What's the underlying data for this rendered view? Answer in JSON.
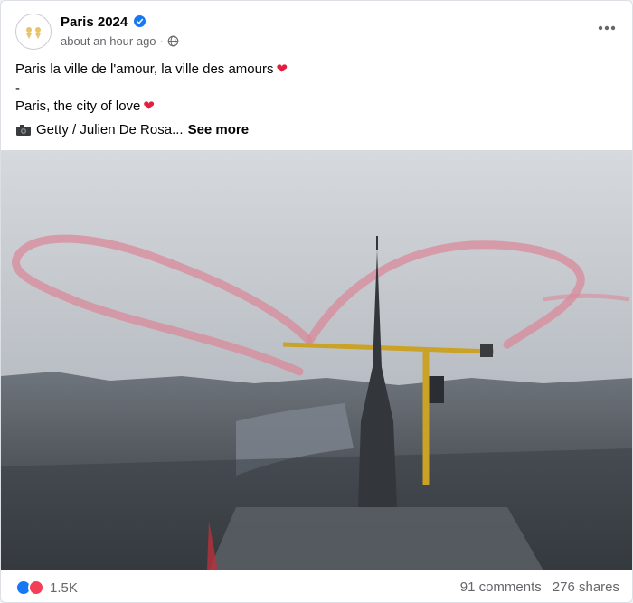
{
  "post": {
    "page_name": "Paris 2024",
    "timestamp": "about an hour ago",
    "text_lines": [
      "Paris la ville de l'amour, la ville des amours",
      "-",
      "Paris, the city of love"
    ],
    "caption_prefix": "Getty / Julien De Rosa...",
    "see_more": "See more",
    "photo_alt": "Aerial view of Paris with a red smoke heart in the sky above a cathedral spire and a construction crane"
  },
  "footer": {
    "reaction_count": "1.5K",
    "comments": "91 comments",
    "shares": "276 shares"
  },
  "icons": {
    "verified": "verified-badge-icon",
    "globe": "globe-icon",
    "more": "more-options-icon",
    "camera": "camera-icon",
    "heart": "red-heart-emoji",
    "like": "like-reaction-icon",
    "love": "love-reaction-icon"
  },
  "colors": {
    "accent": "#1877f2",
    "heart": "#e41e3f",
    "secondary_text": "#65676b"
  }
}
